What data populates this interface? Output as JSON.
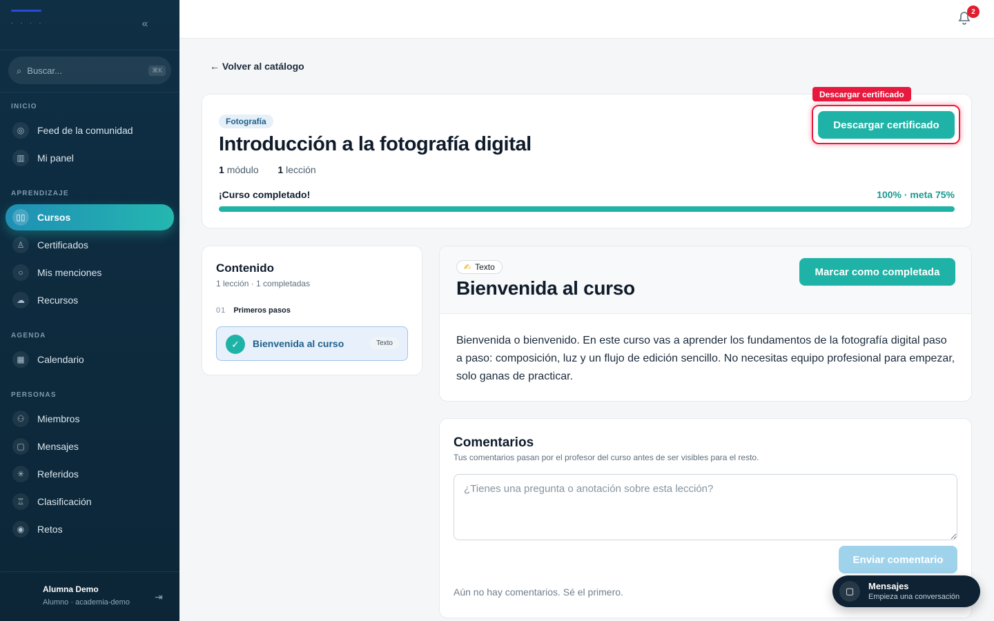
{
  "sidebar": {
    "search_placeholder": "Buscar...",
    "search_shortcut": "⌘K",
    "sections": [
      {
        "label": "INICIO",
        "items": [
          {
            "label": "Feed de la comunidad",
            "icon": "globe-icon"
          },
          {
            "label": "Mi panel",
            "icon": "bar-chart-icon"
          }
        ]
      },
      {
        "label": "APRENDIZAJE",
        "items": [
          {
            "label": "Cursos",
            "icon": "book-icon",
            "active": true
          },
          {
            "label": "Certificados",
            "icon": "award-icon"
          },
          {
            "label": "Mis menciones",
            "icon": "chat-icon"
          },
          {
            "label": "Recursos",
            "icon": "cloud-download-icon"
          }
        ]
      },
      {
        "label": "AGENDA",
        "items": [
          {
            "label": "Calendario",
            "icon": "calendar-icon"
          }
        ]
      },
      {
        "label": "PERSONAS",
        "items": [
          {
            "label": "Miembros",
            "icon": "users-icon"
          },
          {
            "label": "Mensajes",
            "icon": "messages-icon"
          },
          {
            "label": "Referidos",
            "icon": "sparkle-icon"
          },
          {
            "label": "Clasificación",
            "icon": "trophy-icon"
          },
          {
            "label": "Retos",
            "icon": "target-icon"
          }
        ]
      }
    ],
    "user": {
      "name": "Alumna Demo",
      "role": "Alumno · academia-demo"
    }
  },
  "topbar": {
    "notification_count": "2"
  },
  "main": {
    "back_link": "← Volver al catálogo",
    "course": {
      "category": "Fotografía",
      "title": "Introducción a la fotografía digital",
      "modules_count": "1",
      "modules_label": "módulo",
      "lessons_count": "1",
      "lessons_label": "lección",
      "progress_label": "¡Curso completado!",
      "progress_text": "100% · meta 75%",
      "progress_value": 100,
      "certificate_button": "Descargar certificado",
      "certificate_tooltip": "Descargar certificado"
    },
    "content": {
      "title": "Contenido",
      "subtitle": "1 lección · 1 completadas",
      "module_number": "01",
      "module_name": "Primeros pasos",
      "lesson_title": "Bienvenida al curso",
      "lesson_tag": "Texto"
    },
    "lesson": {
      "type_tag": "Texto",
      "type_emoji": "✍",
      "title": "Bienvenida al curso",
      "complete_button": "Marcar como completada",
      "body": "Bienvenida o bienvenido. En este curso vas a aprender los fundamentos de la fotografía digital paso a paso: composición, luz y un flujo de edición sencillo. No necesitas equipo profesional para empezar, solo ganas de practicar."
    },
    "comments": {
      "title": "Comentarios",
      "subtitle": "Tus comentarios pasan por el profesor del curso antes de ser visibles para el resto.",
      "placeholder": "¿Tienes una pregunta o anotación sobre esta lección?",
      "send_button": "Enviar comentario",
      "empty_text": "Aún no hay comentarios. Sé el primero."
    }
  },
  "messages_widget": {
    "title": "Mensajes",
    "subtitle": "Empieza una conversación"
  },
  "colors": {
    "accent": "#1fb3a7",
    "sidebar_bg": "#0f2f45",
    "alert": "#e8193e"
  }
}
